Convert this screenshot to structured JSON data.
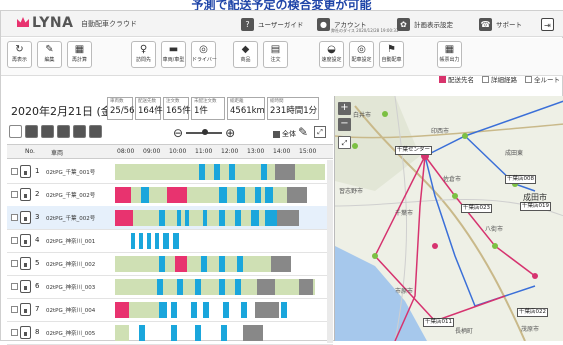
{
  "banner": "予測で配送予定の検合変更が可能",
  "header": {
    "logo": "LYNA",
    "subtitle": "自動配車クラウド",
    "user_guide": "ユーザーガイド",
    "account": "アカウント",
    "account_sub": "弊社のダイス 2020/12/28 19:00:33",
    "plan_settings": "計画表示設定",
    "support": "サポート"
  },
  "toolbar": [
    {
      "label": "再表示",
      "icon": "refresh-icon",
      "glyph": "↻"
    },
    {
      "label": "編集",
      "icon": "pencil-icon",
      "glyph": "✎"
    },
    {
      "label": "再計算",
      "icon": "calculator-icon",
      "glyph": "▦"
    },
    {
      "label": "訪問先",
      "icon": "person-icon",
      "glyph": "♀"
    },
    {
      "label": "車両/車型",
      "icon": "truck-icon",
      "glyph": "▬"
    },
    {
      "label": "ドライバー",
      "icon": "steering-icon",
      "glyph": "◎"
    },
    {
      "label": "商品",
      "icon": "box-icon",
      "glyph": "◆"
    },
    {
      "label": "注文",
      "icon": "document-icon",
      "glyph": "▤"
    },
    {
      "label": "速度設定",
      "icon": "speed-icon",
      "glyph": "◒"
    },
    {
      "label": "配車設定",
      "icon": "settings-icon",
      "glyph": "◎"
    },
    {
      "label": "自動配車",
      "icon": "auto-route-icon",
      "glyph": "⚑"
    },
    {
      "label": "帳票出力",
      "icon": "report-icon",
      "glyph": "▦"
    }
  ],
  "map_options": [
    {
      "label": "配送先名",
      "checked": true
    },
    {
      "label": "詳細経路",
      "checked": false
    },
    {
      "label": "全ルート",
      "checked": false
    }
  ],
  "date": "2020年2月21日 (金)",
  "stats": [
    {
      "title": "車両数",
      "value": "25/56"
    },
    {
      "title": "配送先数",
      "value": "164件"
    },
    {
      "title": "注文数",
      "value": "165件"
    },
    {
      "title": "未配注文数",
      "value": "1件"
    },
    {
      "title": "総距離",
      "value": "4561km"
    },
    {
      "title": "総時間",
      "value": "231時間1分"
    }
  ],
  "zoom_all": "全体",
  "grid": {
    "headers": {
      "no": "No.",
      "name": "車両",
      "times": [
        "08:00",
        "09:00",
        "10:00",
        "11:00",
        "12:00",
        "13:00",
        "14:00",
        "15:00"
      ]
    },
    "rows": [
      {
        "no": "1",
        "name": "02tPG_千葉_001号",
        "selected": false,
        "segs": [
          [
            0,
            14,
            "#cfe0b4"
          ],
          [
            14,
            36,
            "#cfe0b4"
          ],
          [
            50,
            160,
            "#cfe0b4"
          ],
          [
            84,
            6,
            "#1aa6dc"
          ],
          [
            99,
            6,
            "#1aa6dc"
          ],
          [
            114,
            6,
            "#1aa6dc"
          ],
          [
            146,
            6,
            "#1aa6dc"
          ],
          [
            160,
            20,
            "#888888"
          ]
        ]
      },
      {
        "no": "2",
        "name": "02tPG_千葉_002号",
        "selected": false,
        "segs": [
          [
            0,
            16,
            "#e8336f"
          ],
          [
            16,
            176,
            "#cfe0b4"
          ],
          [
            26,
            8,
            "#1aa6dc"
          ],
          [
            52,
            20,
            "#e8336f"
          ],
          [
            104,
            8,
            "#1aa6dc"
          ],
          [
            122,
            8,
            "#1aa6dc"
          ],
          [
            140,
            6,
            "#1aa6dc"
          ],
          [
            150,
            8,
            "#1aa6dc"
          ],
          [
            172,
            20,
            "#888888"
          ]
        ]
      },
      {
        "no": "3",
        "name": "02tPG_千葉_002号",
        "selected": true,
        "segs": [
          [
            0,
            18,
            "#e8336f"
          ],
          [
            18,
            166,
            "#cfe0b4"
          ],
          [
            44,
            6,
            "#1aa6dc"
          ],
          [
            62,
            4,
            "#1aa6dc"
          ],
          [
            70,
            4,
            "#1aa6dc"
          ],
          [
            88,
            4,
            "#1aa6dc"
          ],
          [
            104,
            6,
            "#1aa6dc"
          ],
          [
            120,
            6,
            "#1aa6dc"
          ],
          [
            136,
            8,
            "#1aa6dc"
          ],
          [
            150,
            12,
            "#1aa6dc"
          ],
          [
            162,
            22,
            "#888888"
          ]
        ]
      },
      {
        "no": "4",
        "name": "02tPG_神奈川_001",
        "selected": false,
        "segs": [
          [
            16,
            4,
            "#1aa6dc"
          ],
          [
            24,
            4,
            "#1aa6dc"
          ],
          [
            32,
            4,
            "#1aa6dc"
          ],
          [
            40,
            4,
            "#1aa6dc"
          ],
          [
            48,
            6,
            "#1aa6dc"
          ],
          [
            58,
            6,
            "#1aa6dc"
          ]
        ]
      },
      {
        "no": "5",
        "name": "02tPG_神奈川_002",
        "selected": false,
        "segs": [
          [
            0,
            156,
            "#cfe0b4"
          ],
          [
            44,
            6,
            "#1aa6dc"
          ],
          [
            60,
            12,
            "#e8336f"
          ],
          [
            86,
            6,
            "#1aa6dc"
          ],
          [
            104,
            6,
            "#1aa6dc"
          ],
          [
            122,
            6,
            "#1aa6dc"
          ],
          [
            156,
            20,
            "#888888"
          ]
        ]
      },
      {
        "no": "6",
        "name": "02tPG_神奈川_003",
        "selected": false,
        "segs": [
          [
            0,
            200,
            "#cfe0b4"
          ],
          [
            42,
            6,
            "#1aa6dc"
          ],
          [
            62,
            6,
            "#1aa6dc"
          ],
          [
            80,
            6,
            "#1aa6dc"
          ],
          [
            104,
            6,
            "#1aa6dc"
          ],
          [
            120,
            6,
            "#1aa6dc"
          ],
          [
            142,
            18,
            "#888888"
          ],
          [
            184,
            14,
            "#888888"
          ]
        ]
      },
      {
        "no": "7",
        "name": "02tPG_神奈川_004",
        "selected": false,
        "segs": [
          [
            0,
            14,
            "#e8336f"
          ],
          [
            14,
            30,
            "#cfe0b4"
          ],
          [
            44,
            8,
            "#1aa6dc"
          ],
          [
            56,
            6,
            "#1aa6dc"
          ],
          [
            76,
            6,
            "#1aa6dc"
          ],
          [
            88,
            6,
            "#1aa6dc"
          ],
          [
            108,
            6,
            "#1aa6dc"
          ],
          [
            126,
            6,
            "#1aa6dc"
          ],
          [
            140,
            24,
            "#888888"
          ],
          [
            166,
            6,
            "#1aa6dc"
          ]
        ]
      },
      {
        "no": "8",
        "name": "02tPG_神奈川_005",
        "selected": false,
        "segs": [
          [
            0,
            14,
            "#cfe0b4"
          ],
          [
            24,
            6,
            "#1aa6dc"
          ],
          [
            56,
            6,
            "#1aa6dc"
          ],
          [
            80,
            6,
            "#1aa6dc"
          ],
          [
            106,
            6,
            "#1aa6dc"
          ],
          [
            128,
            20,
            "#888888"
          ]
        ]
      }
    ]
  },
  "map": {
    "labels": [
      {
        "text": "白井市",
        "kind": "city"
      },
      {
        "text": "成田市",
        "kind": "city"
      },
      {
        "text": "印西市",
        "kind": "city"
      },
      {
        "text": "成田東",
        "kind": "city"
      },
      {
        "text": "佐倉市",
        "kind": "city"
      },
      {
        "text": "八街市",
        "kind": "city"
      },
      {
        "text": "市原市",
        "kind": "city"
      },
      {
        "text": "長柄町",
        "kind": "city"
      },
      {
        "text": "茂原市",
        "kind": "city"
      },
      {
        "text": "習志野市",
        "kind": "city"
      },
      {
        "text": "千葉市",
        "kind": "city"
      }
    ],
    "tags": [
      {
        "text": "千葉センター"
      },
      {
        "text": "千葉店008"
      },
      {
        "text": "千葉店019"
      },
      {
        "text": "千葉店023"
      },
      {
        "text": "千葉店022"
      },
      {
        "text": "千葉店011"
      }
    ]
  }
}
